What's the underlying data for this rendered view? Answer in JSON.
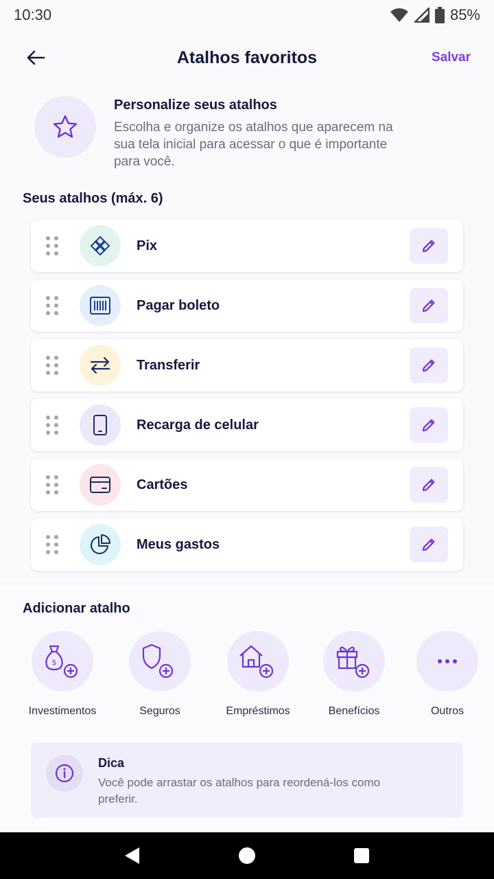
{
  "status": {
    "time": "10:30",
    "battery": "85%"
  },
  "header": {
    "title": "Atalhos favoritos",
    "save_label": "Salvar"
  },
  "intro": {
    "title": "Personalize seus atalhos",
    "description": "Escolha e organize os atalhos que aparecem na sua tela inicial para acessar o que é importante para você."
  },
  "shortcuts": {
    "section_title": "Seus atalhos (máx. 6)",
    "items": [
      {
        "label": "Pix",
        "icon": "pix-icon",
        "bg": "#e3f4ee",
        "color": "#1f3b8f"
      },
      {
        "label": "Pagar boleto",
        "icon": "barcode-icon",
        "bg": "#e4effb",
        "color": "#1f3b8f"
      },
      {
        "label": "Transferir",
        "icon": "transfer-icon",
        "bg": "#fdf3d8",
        "color": "#1f2a5e"
      },
      {
        "label": "Recarga de celular",
        "icon": "phone-icon",
        "bg": "#ece8f8",
        "color": "#1f2a5e"
      },
      {
        "label": "Cartões",
        "icon": "card-icon",
        "bg": "#fce6ea",
        "color": "#1f2a5e"
      },
      {
        "label": "Meus gastos",
        "icon": "pie-chart-icon",
        "bg": "#def4f8",
        "color": "#1f2a5e"
      }
    ]
  },
  "add": {
    "section_title": "Adicionar atalho",
    "items": [
      {
        "label": "Investimentos",
        "icon": "money-bag-icon"
      },
      {
        "label": "Seguros",
        "icon": "shield-icon"
      },
      {
        "label": "Empréstimos",
        "icon": "house-icon"
      },
      {
        "label": "Benefícios",
        "icon": "gift-icon"
      },
      {
        "label": "Outros",
        "icon": "more-icon"
      }
    ]
  },
  "tip": {
    "title": "Dica",
    "description": "Você pode arrastar os atalhos para reordená-los como preferir."
  },
  "colors": {
    "accent": "#7b3fe4",
    "text": "#17183f",
    "muted": "#6b6b7e"
  }
}
